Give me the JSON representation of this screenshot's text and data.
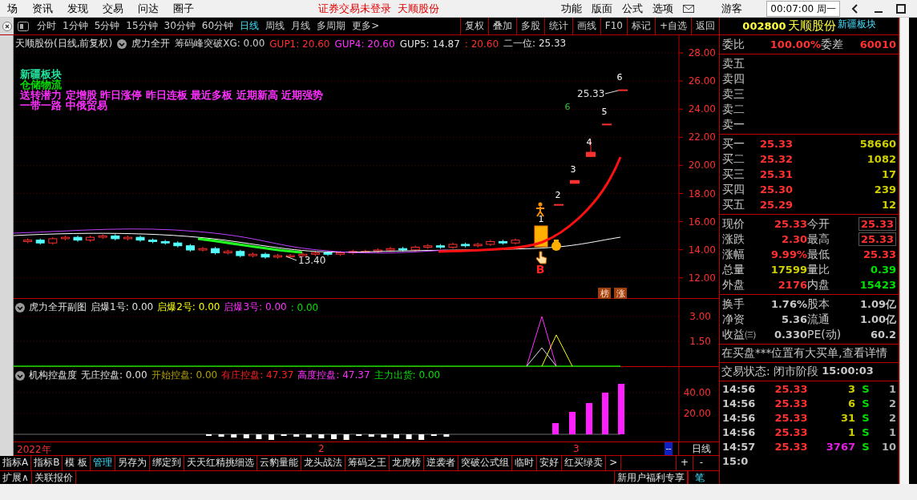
{
  "menu": {
    "items": [
      "场",
      "资讯",
      "发现",
      "交易",
      "问达",
      "圈子"
    ],
    "notice": "证券交易未登录",
    "stock": "天顺股份",
    "tools": [
      "功能",
      "版面",
      "公式",
      "选项"
    ],
    "user": "游客",
    "clock": "00:07:00 周一"
  },
  "period_bar": {
    "periods": [
      {
        "label": "分时",
        "selected": false
      },
      {
        "label": "1分钟",
        "selected": false
      },
      {
        "label": "5分钟",
        "selected": false
      },
      {
        "label": "15分钟",
        "selected": false
      },
      {
        "label": "30分钟",
        "selected": false
      },
      {
        "label": "60分钟",
        "selected": false
      },
      {
        "label": "日线",
        "selected": true
      },
      {
        "label": "周线",
        "selected": false
      },
      {
        "label": "月线",
        "selected": false
      },
      {
        "label": "多周期",
        "selected": false
      },
      {
        "label": "更多>",
        "selected": false
      }
    ],
    "tools": [
      "复权",
      "叠加",
      "多股",
      "统计",
      "画线",
      "F10",
      "标记",
      "+自选",
      "返回"
    ]
  },
  "price_chart": {
    "title": "天顺股份(日线,前复权)",
    "indicator": "虎力全开",
    "readings": [
      {
        "text": "筹码峰突破XG: 0.00",
        "color": "#d0d0d0"
      },
      {
        "text": "GUP1: 20.60",
        "color": "#ff3030"
      },
      {
        "text": "GUP4: 20.60",
        "color": "#ff30ff"
      },
      {
        "text": "GUP5: 14.87",
        "color": "#e0e0e0"
      },
      {
        "text": ": 20.60",
        "color": "#ff3030"
      },
      {
        "text": "二一位: 25.33",
        "color": "#e0e0e0"
      }
    ],
    "tags": [
      {
        "text": "新疆板块",
        "color": "#20e8a0"
      },
      {
        "text": "仓储物流",
        "color": "#00e000"
      },
      {
        "text": "送转潜力 定增股 昨日涨停 昨日连板 最近多板 近期新高 近期强势",
        "color": "#ff30ff"
      },
      {
        "text": "一带一路 中俄贸易",
        "color": "#ff30ff"
      }
    ],
    "y_ticks": [
      "28.00",
      "26.00",
      "24.00",
      "22.00",
      "20.00",
      "18.00",
      "16.00",
      "14.00",
      "12.00"
    ],
    "markers": [
      "1",
      "2",
      "3",
      "4",
      "5",
      "6"
    ],
    "side_marker": "6",
    "last_price": "25.33",
    "low_price": "13.40",
    "signal": "B",
    "badges": [
      "榜",
      "涨"
    ]
  },
  "sub_panes": [
    {
      "title": "虎力全开副图",
      "readings": [
        {
          "text": "启爆1号: 0.00",
          "color": "#e0e0e0"
        },
        {
          "text": "启爆2号: 0.00",
          "color": "#ffff00"
        },
        {
          "text": "启爆3号: 0.00",
          "color": "#ff30ff"
        },
        {
          "text": ": 0.00",
          "color": "#00e000"
        }
      ],
      "y_ticks": [
        "3.00",
        "1.50"
      ]
    },
    {
      "title": "机构控盘度",
      "readings": [
        {
          "text": "无庄控盘: 0.00",
          "color": "#e0e0e0"
        },
        {
          "text": "开始控盘: 0.00",
          "color": "#b0a000"
        },
        {
          "text": "有庄控盘: 47.37",
          "color": "#ff2020"
        },
        {
          "text": "高度控盘: 47.37",
          "color": "#ff30ff"
        },
        {
          "text": "主力出货: 0.00",
          "color": "#00e000"
        }
      ],
      "y_ticks": [
        "40.00",
        "20.00"
      ]
    }
  ],
  "date_axis": {
    "labels": [
      "2022年",
      "2",
      "3"
    ],
    "button": "--",
    "period": "日线"
  },
  "formula_tabs": {
    "tabs": [
      {
        "label": "指标A",
        "selected": false
      },
      {
        "label": "指标B",
        "selected": false
      },
      {
        "label": "模 板",
        "selected": false
      },
      {
        "label": "管理",
        "selected": true
      },
      {
        "label": "另存为",
        "selected": false
      },
      {
        "label": "绑定到",
        "selected": false
      },
      {
        "label": "天天红精挑细选",
        "selected": false
      },
      {
        "label": "云豹量能",
        "selected": false
      },
      {
        "label": "龙头战法",
        "selected": false
      },
      {
        "label": "筹码之王",
        "selected": false
      },
      {
        "label": "龙虎榜",
        "selected": false
      },
      {
        "label": "逆袭者",
        "selected": false
      },
      {
        "label": "突破公式组",
        "selected": false
      },
      {
        "label": "临时",
        "selected": false
      },
      {
        "label": "安好",
        "selected": false
      },
      {
        "label": "红买绿卖",
        "selected": false
      }
    ],
    "more": ">",
    "zoom": [
      "+",
      "-"
    ],
    "row2": [
      "扩展∧",
      "关联报价"
    ],
    "promo": "新用户福利专享",
    "pen": "笔"
  },
  "quote": {
    "code": "002800",
    "name": "天顺股份",
    "sector": "新疆板块",
    "ratio": {
      "label": "委比",
      "value": "100.00%",
      "label2": "委差",
      "value2": "60010"
    },
    "asks": [
      "卖五",
      "卖四",
      "卖三",
      "卖二",
      "卖一"
    ],
    "bids": [
      {
        "label": "买一",
        "price": "25.33",
        "volume": "58660"
      },
      {
        "label": "买二",
        "price": "25.32",
        "volume": "1082"
      },
      {
        "label": "买三",
        "price": "25.31",
        "volume": "17"
      },
      {
        "label": "买四",
        "price": "25.30",
        "volume": "239"
      },
      {
        "label": "买五",
        "price": "25.29",
        "volume": "12"
      }
    ],
    "stats": [
      {
        "left": {
          "label": "现价",
          "value": "25.33",
          "color": "#ff3030"
        },
        "right": {
          "label": "今开",
          "value": "25.33",
          "color": "#ff3030",
          "boxed": true
        }
      },
      {
        "left": {
          "label": "涨跌",
          "value": "2.30",
          "color": "#ff3030"
        },
        "right": {
          "label": "最高",
          "value": "25.33",
          "color": "#ff3030",
          "boxed": true
        }
      },
      {
        "left": {
          "label": "涨幅",
          "value": "9.99%",
          "color": "#ff3030"
        },
        "right": {
          "label": "最低",
          "value": "25.33",
          "color": "#ff3030",
          "boxed": false
        }
      },
      {
        "left": {
          "label": "总量",
          "value": "17599",
          "color": "#d0d000"
        },
        "right": {
          "label": "量比",
          "value": "0.39",
          "color": "#00e000",
          "boxed": false
        }
      },
      {
        "left": {
          "label": "外盘",
          "value": "2176",
          "color": "#ff3030"
        },
        "right": {
          "label": "内盘",
          "value": "15423",
          "color": "#00e000",
          "boxed": false
        }
      }
    ],
    "fundamentals": [
      {
        "label": "换手",
        "value": "1.76%",
        "label2": "股本",
        "value2": "1.09亿"
      },
      {
        "label": "净资",
        "value": "5.36",
        "label2": "流通",
        "value2": "1.00亿"
      },
      {
        "label": "收益㈢",
        "value": "0.330",
        "label2": "PE(动)",
        "value2": "60.2"
      }
    ],
    "message": "在买盘***位置有大买单,查看详情",
    "status": {
      "label": "交易状态: 闭市阶段",
      "time": "15:00:03"
    },
    "ticks": [
      {
        "time": "14:56",
        "price": "25.33",
        "volume": {
          "text": "3",
          "color": "#d0d000"
        },
        "side": "S",
        "count": "1"
      },
      {
        "time": "14:56",
        "price": "25.33",
        "volume": {
          "text": "6",
          "color": "#d0d000"
        },
        "side": "S",
        "count": "2"
      },
      {
        "time": "14:56",
        "price": "25.33",
        "volume": {
          "text": "31",
          "color": "#d0d000"
        },
        "side": "S",
        "count": "2"
      },
      {
        "time": "14:56",
        "price": "25.33",
        "volume": {
          "text": "1",
          "color": "#d0d000"
        },
        "side": "S",
        "count": "1"
      },
      {
        "time": "14:57",
        "price": "25.33",
        "volume": {
          "text": "3767",
          "color": "#e020e0"
        },
        "side": "S",
        "count": "10"
      },
      {
        "time": "15:0"
      }
    ]
  }
}
